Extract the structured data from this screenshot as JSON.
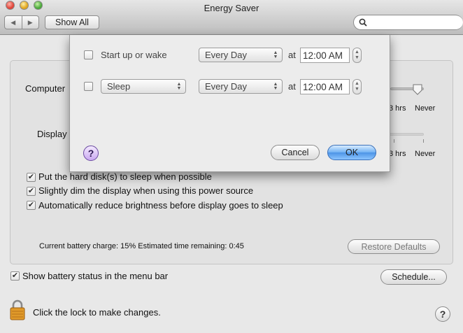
{
  "window": {
    "title": "Energy Saver"
  },
  "toolbar": {
    "show_all_label": "Show All",
    "search_placeholder": ""
  },
  "main": {
    "computer_sleep_label": "Computer",
    "display_sleep_label": "Display",
    "computer_slider_labels": [
      "3 hrs",
      "Never"
    ],
    "display_slider_labels": [
      "3 hrs",
      "Never"
    ],
    "options": [
      {
        "label": "Put the hard disk(s) to sleep when possible",
        "checked": true
      },
      {
        "label": "Slightly dim the display when using this power source",
        "checked": true
      },
      {
        "label": "Automatically reduce brightness before display goes to sleep",
        "checked": true
      }
    ],
    "battery_status": "Current battery charge: 15%  Estimated time remaining: 0:45",
    "restore_defaults_label": "Restore Defaults"
  },
  "footer": {
    "show_battery_label": "Show battery status in the menu bar",
    "show_battery_checked": true,
    "schedule_label": "Schedule...",
    "lock_text": "Click the lock to make changes."
  },
  "schedule_sheet": {
    "startup": {
      "label": "Start up or wake",
      "checked": false,
      "day": "Every Day",
      "at": "at",
      "time": "12:00 AM"
    },
    "sleep": {
      "action": "Sleep",
      "checked": false,
      "day": "Every Day",
      "at": "at",
      "time": "12:00 AM"
    },
    "cancel_label": "Cancel",
    "ok_label": "OK"
  }
}
